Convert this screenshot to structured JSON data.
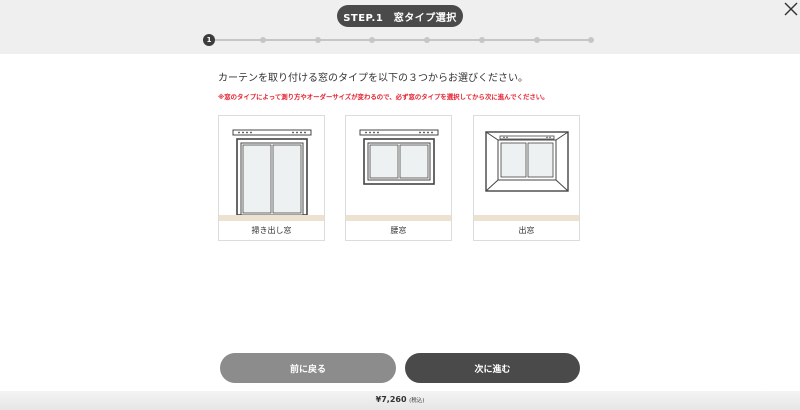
{
  "header": {
    "step_title": "STEP.1　窓タイプ選択",
    "close_icon": "close-icon"
  },
  "progress": {
    "current_step": 1,
    "total_steps": 8,
    "active_label": "1"
  },
  "main": {
    "instruction": "カーテンを取り付ける窓のタイプを以下の３つからお選びください。",
    "warning": "※窓のタイプによって測り方やオーダーサイズが変わるので、必ず窓のタイプを選択してから次に進んでください。",
    "window_types": [
      {
        "label": "掃き出し窓",
        "icon": "tall-window-icon"
      },
      {
        "label": "腰窓",
        "icon": "waist-window-icon"
      },
      {
        "label": "出窓",
        "icon": "bay-window-icon"
      }
    ]
  },
  "footer": {
    "back_label": "前に戻る",
    "next_label": "次に進む",
    "price": "¥7,260",
    "tax_note": "(税込)"
  },
  "colors": {
    "dark": "#4a4a4a",
    "gray_button": "#8c8c8c",
    "warning": "#e5202e",
    "floor": "#ece2cf"
  }
}
